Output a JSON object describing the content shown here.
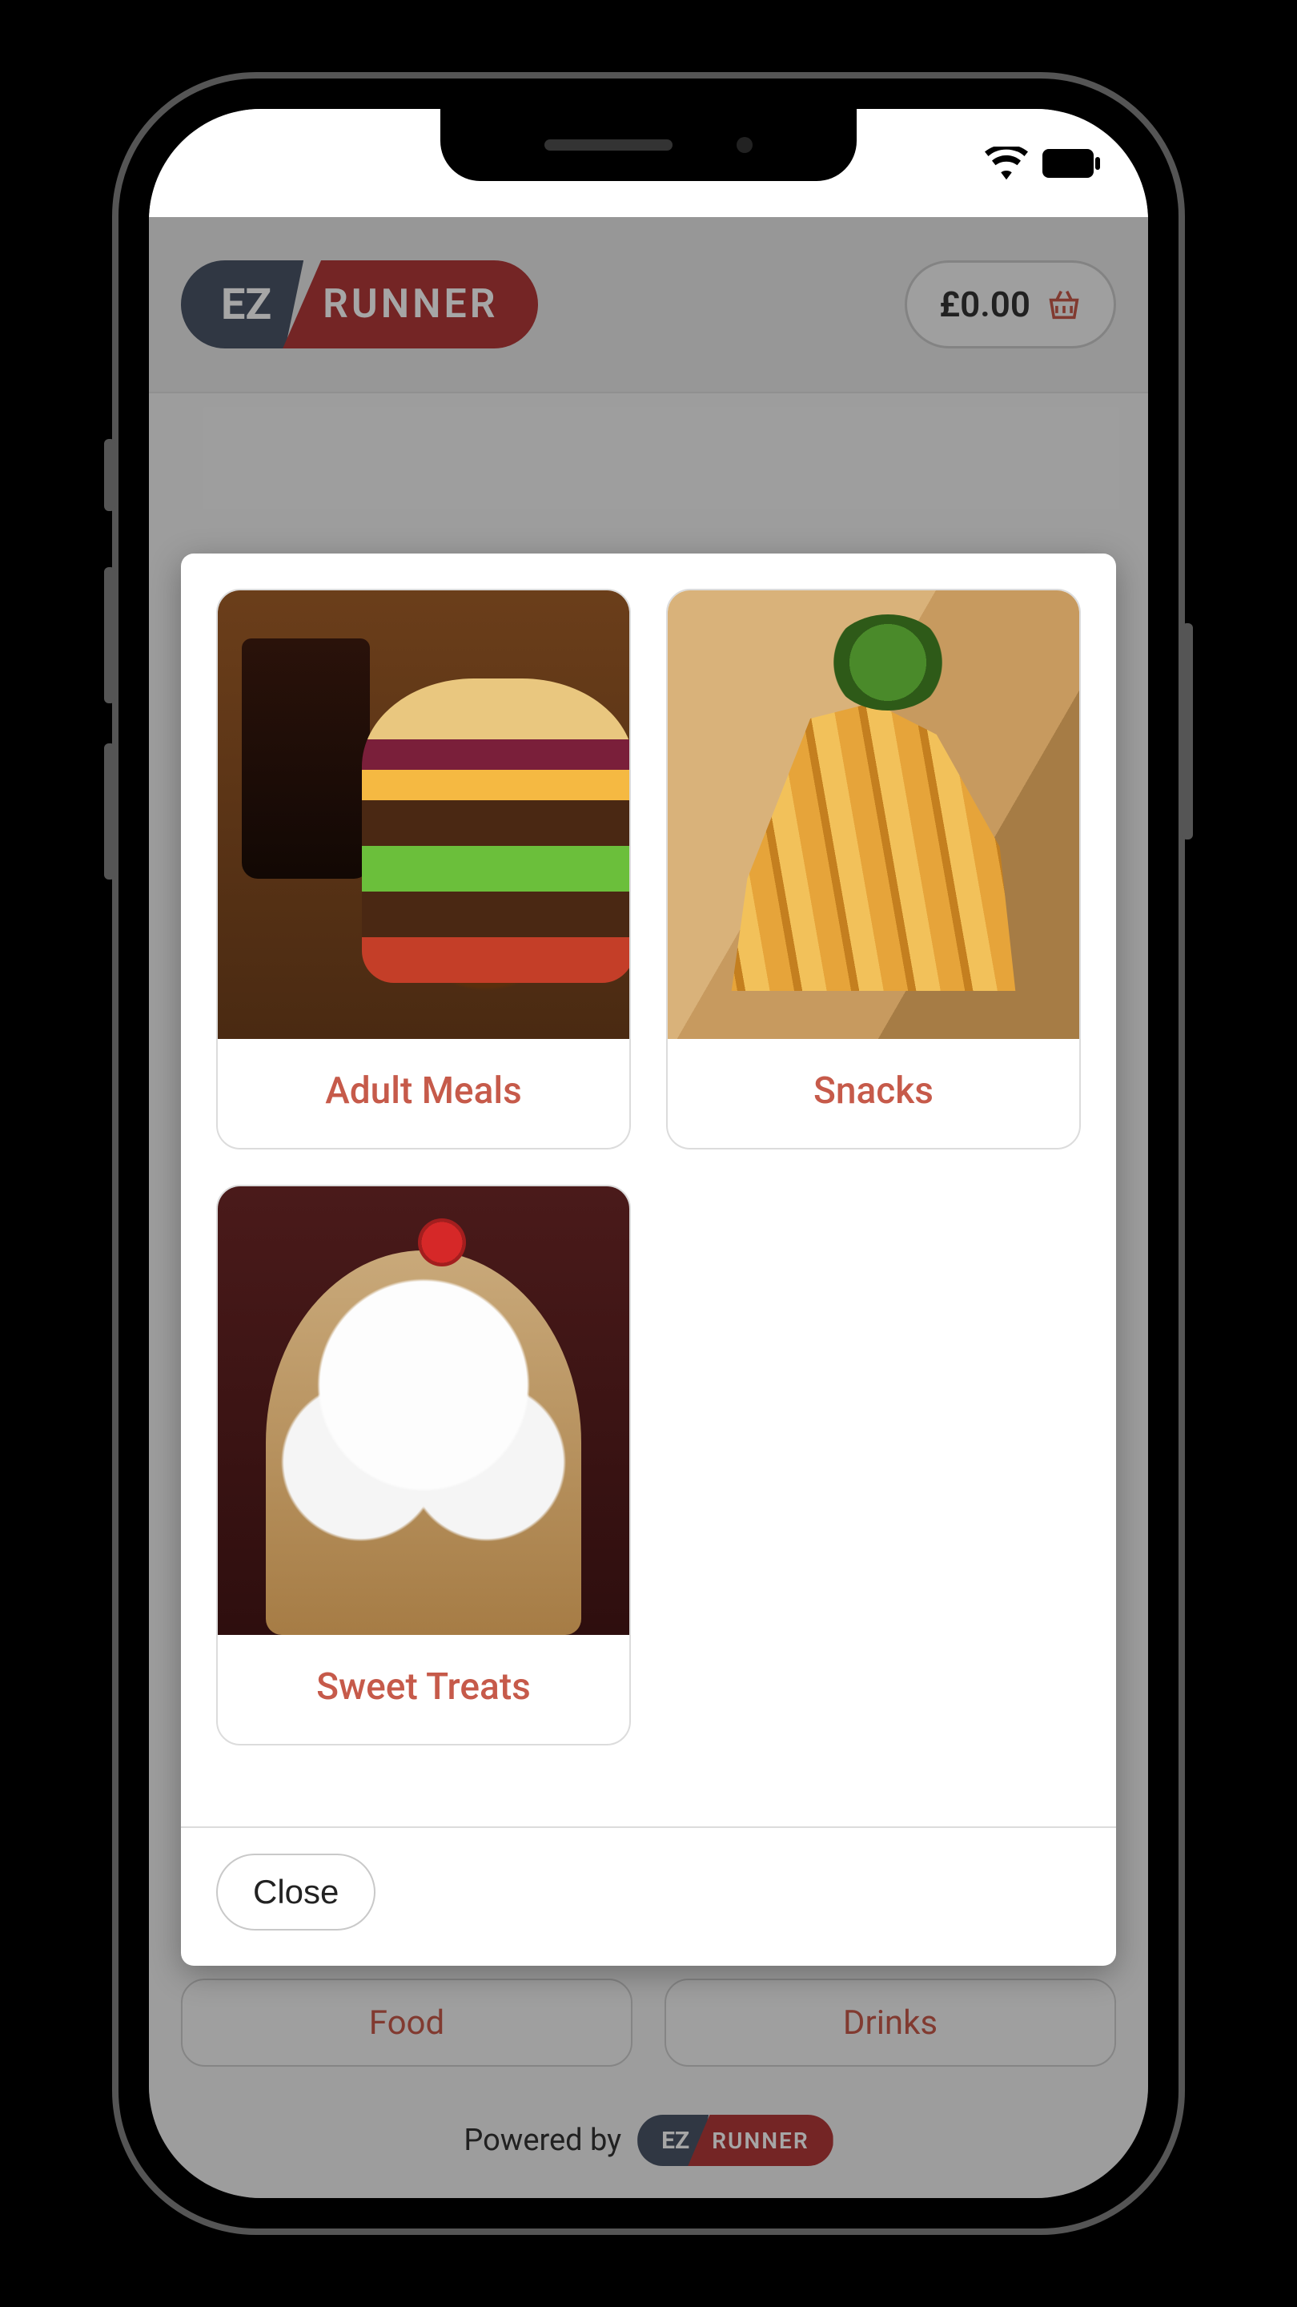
{
  "status": {
    "wifi": true,
    "battery_full": true
  },
  "header": {
    "logo_left": "EZ",
    "logo_right": "RUNNER",
    "cart_amount": "£0.00"
  },
  "modal": {
    "categories": [
      {
        "label": "Adult Meals",
        "image": "burger"
      },
      {
        "label": "Snacks",
        "image": "fries"
      },
      {
        "label": "Sweet Treats",
        "image": "sundae"
      }
    ],
    "close_label": "Close"
  },
  "background": {
    "tabs": [
      {
        "label": "Food"
      },
      {
        "label": "Drinks"
      }
    ],
    "powered_by": "Powered by"
  }
}
